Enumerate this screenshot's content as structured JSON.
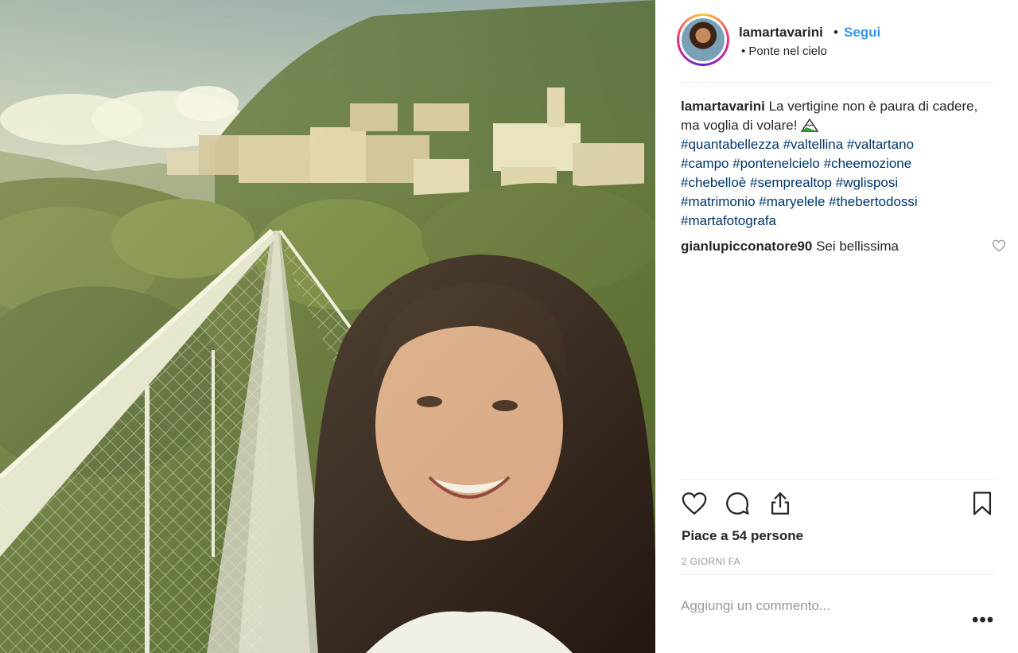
{
  "post": {
    "username": "lamartavarini",
    "separator": "•",
    "follow_label": "Segui",
    "location": "Ponte nel cielo",
    "photo_icon": "selfie-photo"
  },
  "caption": {
    "username": "lamartavarini",
    "text": "La vertigine non è paura di cadere, ma voglia di volare!",
    "emoji_icon": "mountain-icon",
    "hashtags": [
      "#quantabellezza",
      "#valtellina",
      "#valtartano",
      "#campo",
      "#pontenelcielo",
      "#cheemozione",
      "#chebelloè",
      "#semprealtop",
      "#wglisposi",
      "#matrimonio",
      "#maryelele",
      "#thebertodossi",
      "#martafotografa"
    ]
  },
  "comments": [
    {
      "username": "gianlupicconatore90",
      "text": "Sei bellissima"
    }
  ],
  "actions": {
    "like_icon": "heart-icon",
    "comment_icon": "comment-bubble-icon",
    "share_icon": "share-icon",
    "save_icon": "bookmark-icon"
  },
  "likes_text": "Piace a 54 persone",
  "date_text": "2 GIORNI FA",
  "comment_input": {
    "placeholder": "Aggiungi un commento...",
    "value": ""
  },
  "more_label": "•••",
  "colors": {
    "link": "#3897f0",
    "hashtag": "#003569",
    "muted": "#999999",
    "text": "#262626"
  }
}
